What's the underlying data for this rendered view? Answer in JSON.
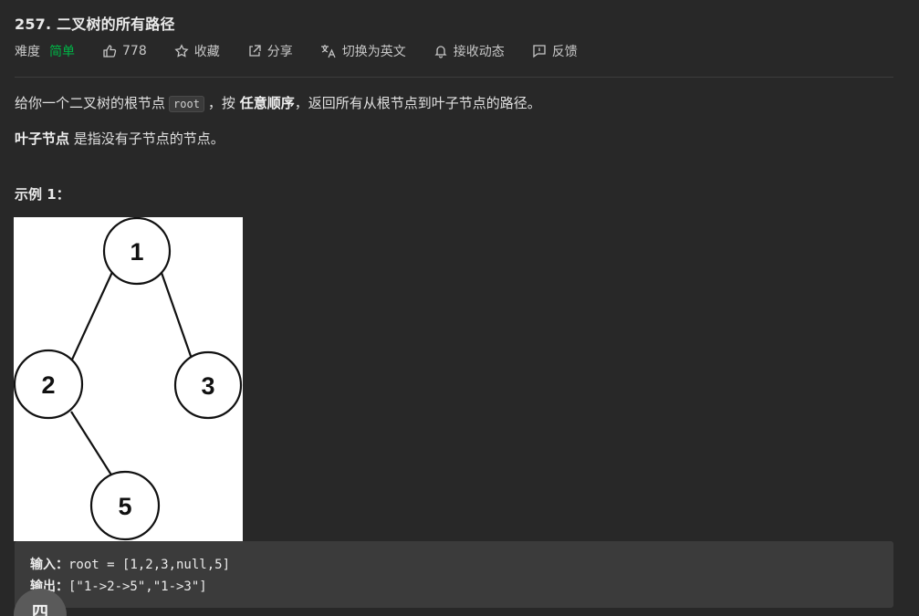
{
  "problem": {
    "title": "257. 二叉树的所有路径"
  },
  "meta": {
    "difficulty_label": "难度",
    "difficulty_value": "简单",
    "likes": "778",
    "collect": "收藏",
    "share": "分享",
    "switch_lang": "切换为英文",
    "subscribe": "接收动态",
    "feedback": "反馈",
    "colors": {
      "difficulty": "#00b446",
      "background": "#282828"
    }
  },
  "description": {
    "line1_pre": "给你一个二叉树的根节点",
    "line1_code": "root",
    "line1_mid": "，按",
    "line1_bold": "任意顺序",
    "line1_post": "，返回所有从根节点到叶子节点的路径。",
    "line2_bold": "叶子节点",
    "line2_post": "是指没有子节点的节点。"
  },
  "example": {
    "title": "示例 1：",
    "tree_nodes": [
      "1",
      "2",
      "3",
      "5"
    ],
    "input_label": "输入：",
    "input_value": "root = [1,2,3,null,5]",
    "output_label": "输出：",
    "output_value": "[\"1->2->5\",\"1->3\"]"
  },
  "floating_button": {
    "label": "四"
  }
}
